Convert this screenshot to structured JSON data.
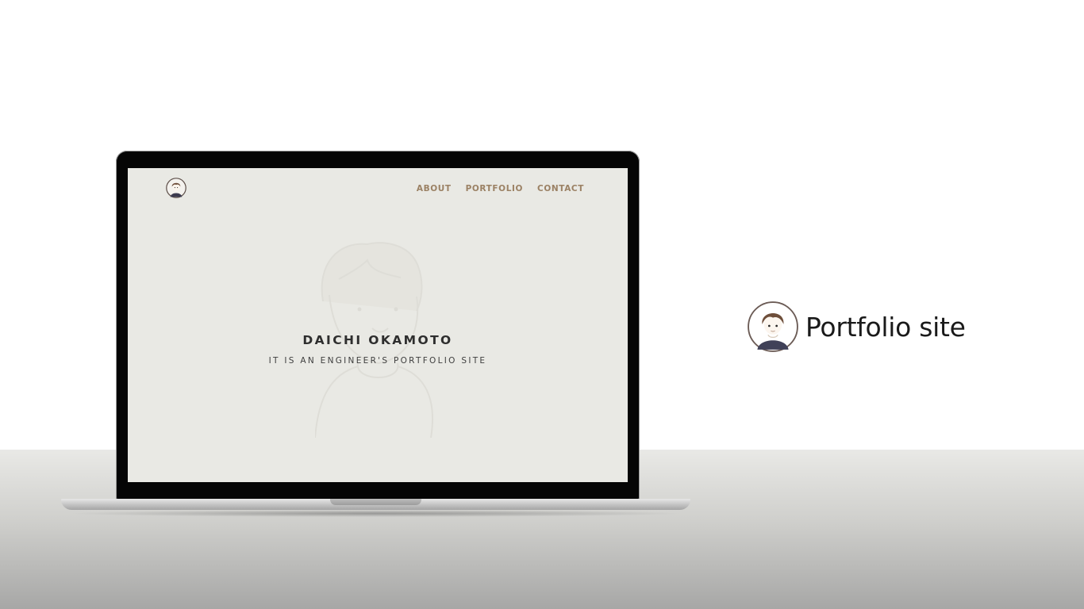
{
  "site": {
    "nav": {
      "about": "ABOUT",
      "portfolio": "PORTFOLIO",
      "contact": "CONTACT"
    },
    "hero": {
      "title": "DAICHI OKAMOTO",
      "subtitle": "IT IS AN ENGINEER'S PORTFOLIO SITE"
    },
    "avatar_icon": "user-avatar-icon",
    "colors": {
      "screen_bg": "#e9e9e4",
      "nav_text": "#9b8164",
      "title_text": "#2e2e2e"
    }
  },
  "brand": {
    "label": "Portfolio site",
    "avatar_icon": "user-avatar-icon"
  }
}
